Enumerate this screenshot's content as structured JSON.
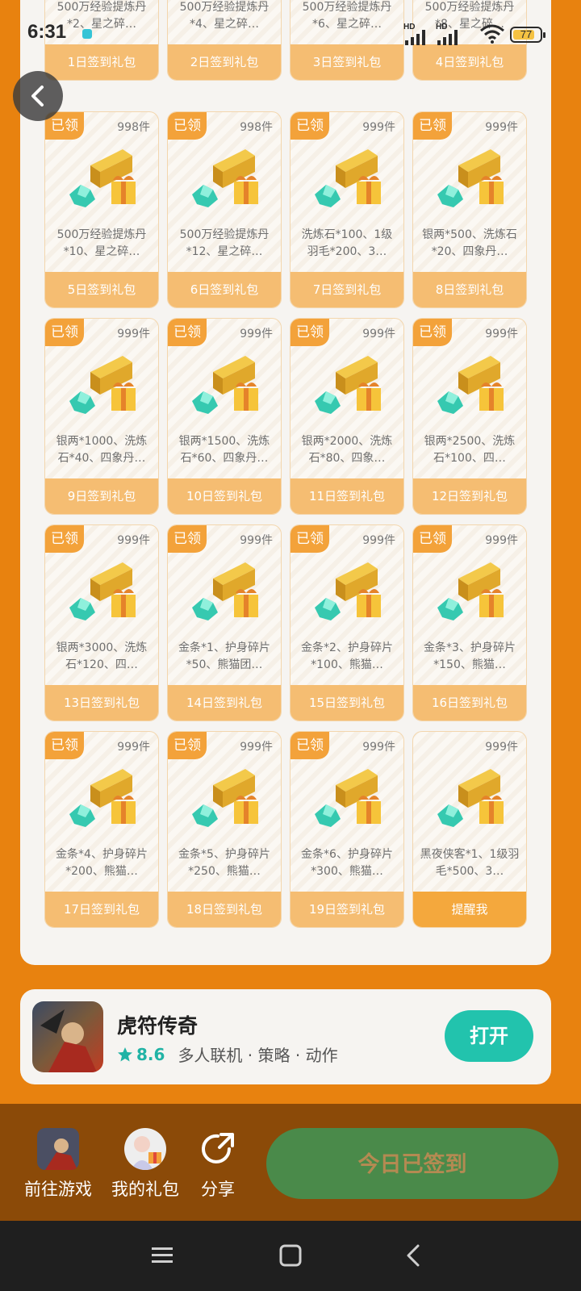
{
  "status_bar": {
    "time": "6:31",
    "network_label": "HD",
    "battery_level": "77"
  },
  "gift_cards": [
    {
      "claimed": false,
      "badge": "",
      "count": "",
      "desc": "500万经验提炼丹*2、星之碎…",
      "footer": "1日签到礼包"
    },
    {
      "claimed": false,
      "badge": "",
      "count": "",
      "desc": "500万经验提炼丹*4、星之碎…",
      "footer": "2日签到礼包"
    },
    {
      "claimed": false,
      "badge": "",
      "count": "",
      "desc": "500万经验提炼丹*6、星之碎…",
      "footer": "3日签到礼包"
    },
    {
      "claimed": false,
      "badge": "",
      "count": "",
      "desc": "500万经验提炼丹*8、星之碎…",
      "footer": "4日签到礼包"
    },
    {
      "claimed": true,
      "badge": "已领",
      "count": "998件",
      "desc": "500万经验提炼丹*10、星之碎…",
      "footer": "5日签到礼包"
    },
    {
      "claimed": true,
      "badge": "已领",
      "count": "998件",
      "desc": "500万经验提炼丹*12、星之碎…",
      "footer": "6日签到礼包"
    },
    {
      "claimed": true,
      "badge": "已领",
      "count": "999件",
      "desc": "洗炼石*100、1级羽毛*200、3…",
      "footer": "7日签到礼包"
    },
    {
      "claimed": true,
      "badge": "已领",
      "count": "999件",
      "desc": "银两*500、洗炼石*20、四象丹…",
      "footer": "8日签到礼包"
    },
    {
      "claimed": true,
      "badge": "已领",
      "count": "999件",
      "desc": "银两*1000、洗炼石*40、四象丹…",
      "footer": "9日签到礼包"
    },
    {
      "claimed": true,
      "badge": "已领",
      "count": "999件",
      "desc": "银两*1500、洗炼石*60、四象丹…",
      "footer": "10日签到礼包"
    },
    {
      "claimed": true,
      "badge": "已领",
      "count": "999件",
      "desc": "银两*2000、洗炼石*80、四象…",
      "footer": "11日签到礼包"
    },
    {
      "claimed": true,
      "badge": "已领",
      "count": "999件",
      "desc": "银两*2500、洗炼石*100、四…",
      "footer": "12日签到礼包"
    },
    {
      "claimed": true,
      "badge": "已领",
      "count": "999件",
      "desc": "银两*3000、洗炼石*120、四…",
      "footer": "13日签到礼包"
    },
    {
      "claimed": true,
      "badge": "已领",
      "count": "999件",
      "desc": "金条*1、护身碎片*50、熊猫团…",
      "footer": "14日签到礼包"
    },
    {
      "claimed": true,
      "badge": "已领",
      "count": "999件",
      "desc": "金条*2、护身碎片*100、熊猫…",
      "footer": "15日签到礼包"
    },
    {
      "claimed": true,
      "badge": "已领",
      "count": "999件",
      "desc": "金条*3、护身碎片*150、熊猫…",
      "footer": "16日签到礼包"
    },
    {
      "claimed": true,
      "badge": "已领",
      "count": "999件",
      "desc": "金条*4、护身碎片*200、熊猫…",
      "footer": "17日签到礼包"
    },
    {
      "claimed": true,
      "badge": "已领",
      "count": "999件",
      "desc": "金条*5、护身碎片*250、熊猫…",
      "footer": "18日签到礼包"
    },
    {
      "claimed": true,
      "badge": "已领",
      "count": "999件",
      "desc": "金条*6、护身碎片*300、熊猫…",
      "footer": "19日签到礼包"
    },
    {
      "claimed": false,
      "badge": "",
      "count": "999件",
      "desc": "黑夜侠客*1、1级羽毛*500、3…",
      "footer": "提醒我",
      "remind": true
    }
  ],
  "game": {
    "title": "虎符传奇",
    "rating": "8.6",
    "tags": "多人联机 · 策略 · 动作",
    "open_label": "打开"
  },
  "actions": {
    "go_game": "前往游戏",
    "my_gifts": "我的礼包",
    "share": "分享",
    "signed_label": "今日已签到"
  },
  "colors": {
    "page_bg": "#e8820f",
    "claimed_badge": "#f3a23a",
    "card_footer": "#f5bd72",
    "open_button": "#22c3ad",
    "signed_button": "#4a8a4a"
  }
}
